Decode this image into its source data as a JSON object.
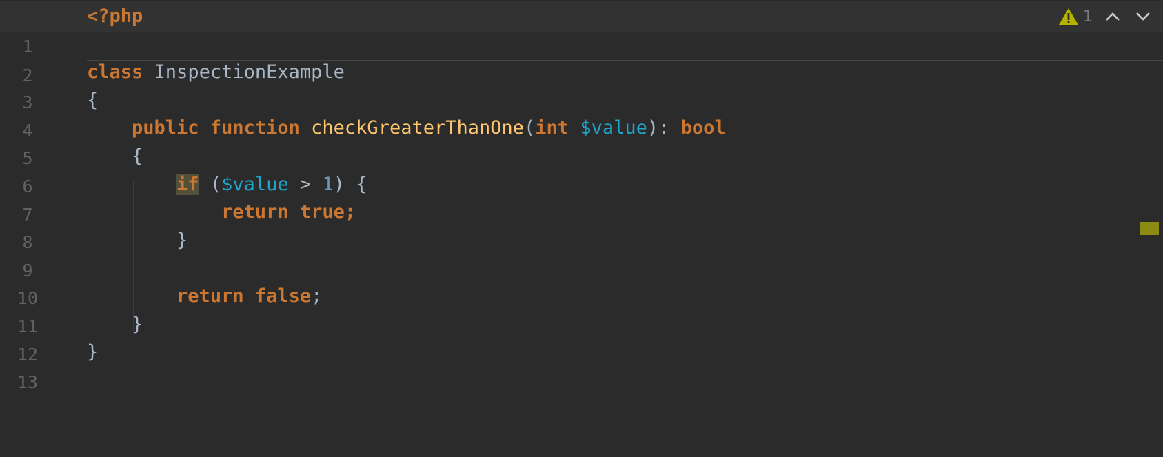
{
  "editor": {
    "lines": [
      {
        "num": "1"
      },
      {
        "num": "2"
      },
      {
        "num": "3"
      },
      {
        "num": "4"
      },
      {
        "num": "5"
      },
      {
        "num": "6"
      },
      {
        "num": "7"
      },
      {
        "num": "8"
      },
      {
        "num": "9"
      },
      {
        "num": "10"
      },
      {
        "num": "11"
      },
      {
        "num": "12"
      },
      {
        "num": "13"
      }
    ],
    "tokens": {
      "php_open": "<?php",
      "class_kw": "class",
      "class_name": "InspectionExample",
      "brace_open": "{",
      "brace_close": "}",
      "public_kw": "public",
      "function_kw": "function",
      "method_name": "checkGreaterThanOne",
      "paren_open": "(",
      "paren_close": ")",
      "int_kw": "int",
      "param_var": "$value",
      "colon": ":",
      "bool_kw": "bool",
      "if_kw": "if",
      "gt_op": ">",
      "num_one": "1",
      "return_kw": "return",
      "true_kw": "true",
      "false_kw": "false",
      "semicolon": ";"
    }
  },
  "inspection": {
    "warning_count": "1",
    "warning_icon": "warning-triangle-icon",
    "prev_icon": "chevron-up-icon",
    "next_icon": "chevron-down-icon",
    "warning_color": "#b3b300"
  },
  "colors": {
    "background": "#2b2b2b",
    "keyword": "#cc7832",
    "function": "#ffc66d",
    "variable": "#21a4c9",
    "number": "#6897bb",
    "text": "#a9b7c6",
    "line_number": "#606366",
    "stripe_marker": "#8c8c13"
  }
}
